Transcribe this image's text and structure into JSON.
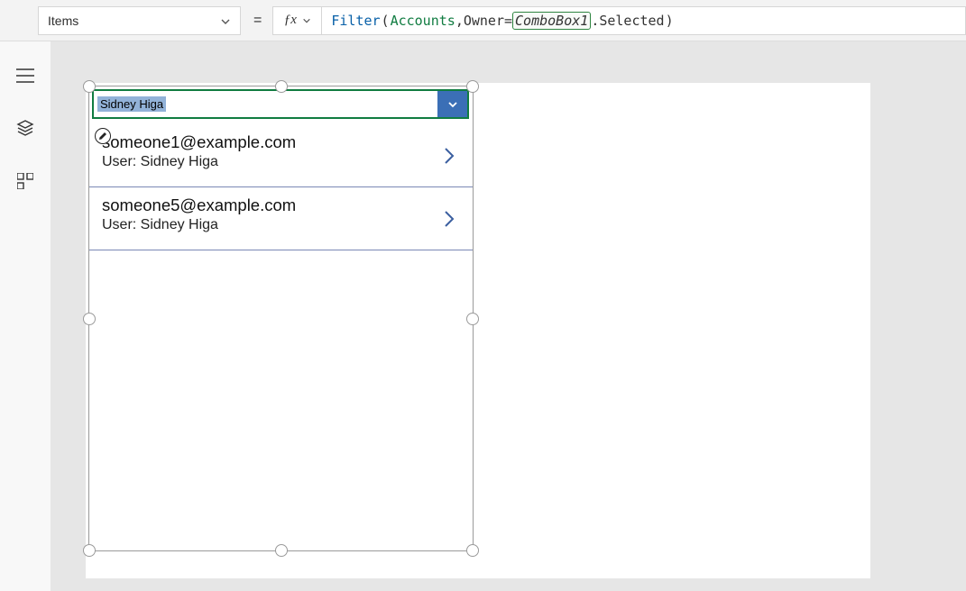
{
  "topbar": {
    "property_name": "Items",
    "formula": {
      "func": "Filter",
      "table": "Accounts",
      "field": "Owner",
      "control": "ComboBox1",
      "member": ".Selected"
    }
  },
  "combo": {
    "selected_value": "Sidney Higa"
  },
  "gallery": {
    "rows": [
      {
        "title": "someone1@example.com",
        "subtitle": "User: Sidney Higa"
      },
      {
        "title": "someone5@example.com",
        "subtitle": "User: Sidney Higa"
      }
    ]
  }
}
